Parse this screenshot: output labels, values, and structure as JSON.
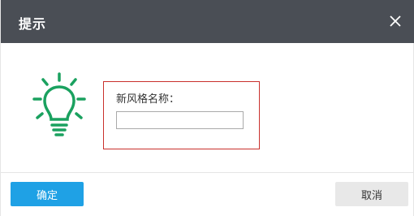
{
  "dialog": {
    "title": "提示",
    "close_icon": "close-icon",
    "bulb_icon": "lightbulb-icon",
    "accent_color": "#1aa15f"
  },
  "form": {
    "label": "新风格名称：",
    "input_value": "",
    "input_placeholder": "",
    "highlight_color": "#c9302c"
  },
  "footer": {
    "ok_label": "确定",
    "cancel_label": "取消",
    "ok_color": "#1fa1e5"
  }
}
